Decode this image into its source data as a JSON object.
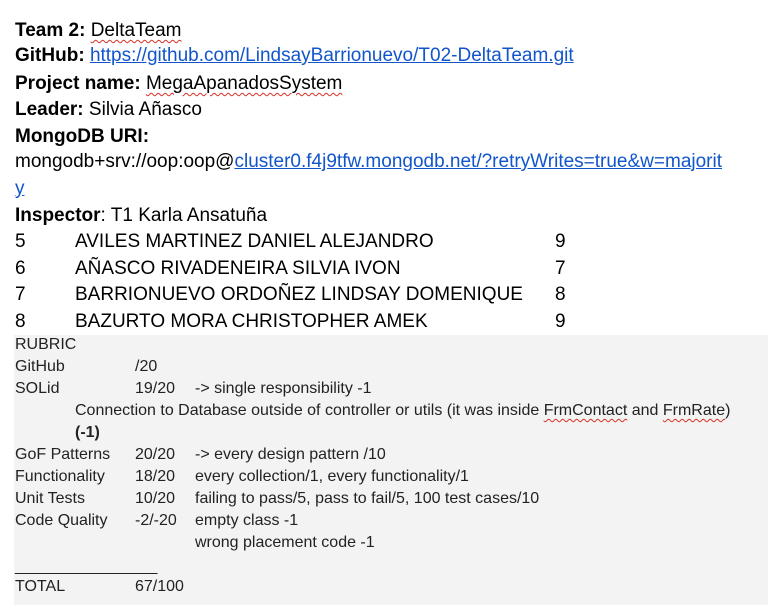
{
  "header": {
    "team_label": "Team 2:",
    "team_value": "DeltaTeam",
    "github_label": "GitHub:",
    "github_url": "https://github.com/LindsayBarrionuevo/T02-DeltaTeam.git",
    "project_label": "Project name:",
    "project_value": "MegaApanadosSystem",
    "leader_label": "Leader:",
    "leader_value": "Silvia Añasco",
    "mongo_label": "MongoDB URI:",
    "mongo_prefix": "mongodb+srv://oop:oop@",
    "mongo_link_line1": "cluster0.f4j9tfw.mongodb.net/?retryWrites=true&w=majorit",
    "mongo_link_line2": "y",
    "inspector_label": "Inspector",
    "inspector_value": ": T1 Karla Ansatuña"
  },
  "members": [
    {
      "num": "5",
      "name": "AVILES MARTINEZ DANIEL ALEJANDRO",
      "score": "9"
    },
    {
      "num": "6",
      "name": "AÑASCO RIVADENEIRA SILVIA IVON",
      "score": "7"
    },
    {
      "num": "7",
      "name": "BARRIONUEVO ORDOÑEZ LINDSAY DOMENIQUE",
      "score": "8"
    },
    {
      "num": "8",
      "name": "BAZURTO MORA CHRISTOPHER AMEK",
      "score": "9"
    }
  ],
  "rubric": {
    "title": "RUBRIC",
    "github": {
      "label": "GitHub",
      "score": "/20"
    },
    "solid": {
      "label": "SOLid",
      "score": "19/20",
      "note": "-> single responsibility -1"
    },
    "solid_detail_pre": "Connection to Database outside of controller or utils (it was inside ",
    "solid_detail_frm1": "FrmContact",
    "solid_detail_mid": " and ",
    "solid_detail_frm2": "FrmRate",
    "solid_detail_post": ")",
    "solid_penalty": "(-1)",
    "gof": {
      "label": "GoF Patterns",
      "score": "20/20",
      "note": "-> every design pattern /10"
    },
    "functionality": {
      "label": "Functionality",
      "score": "18/20",
      "note": "every collection/1, every functionality/1"
    },
    "unit_tests": {
      "label": "Unit Tests",
      "score": "10/20",
      "note": "failing to pass/5, pass to fail/5, 100 test cases/10"
    },
    "code_quality": {
      "label": "Code Quality",
      "score": "-2/-20",
      "note": "empty class -1"
    },
    "code_quality_note2": "wrong placement code -1",
    "separator": "________________",
    "total": {
      "label": "TOTAL",
      "score": "67/100"
    }
  }
}
